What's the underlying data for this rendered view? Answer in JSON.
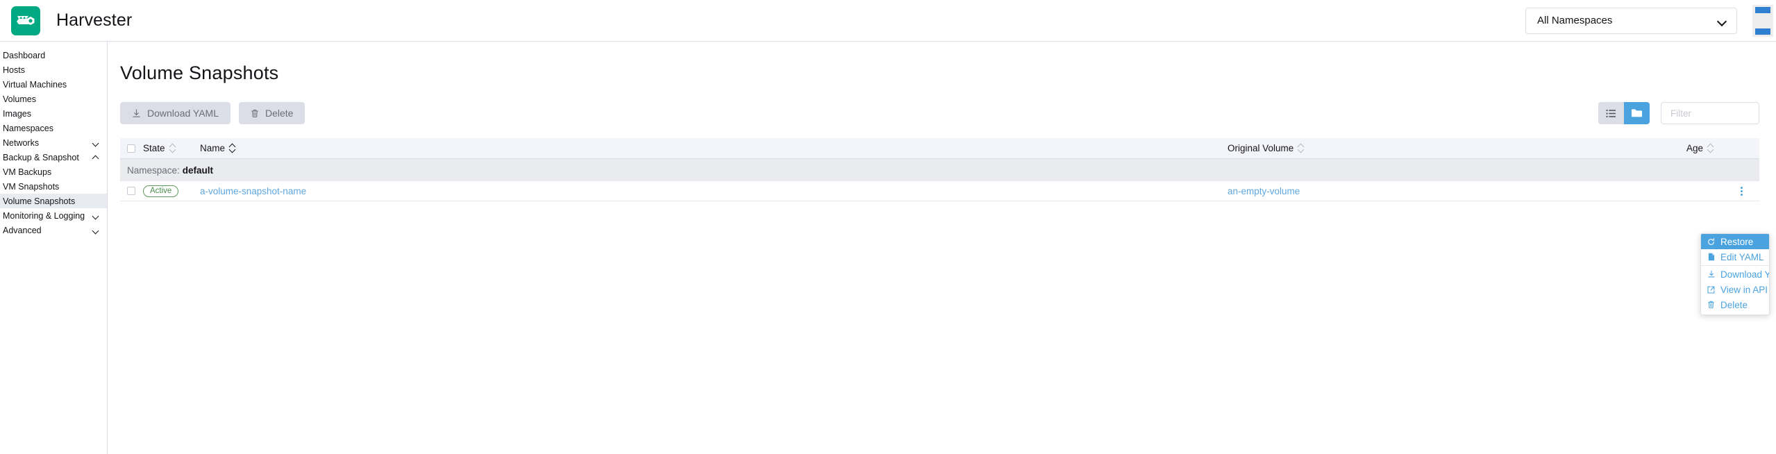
{
  "header": {
    "brand_name": "Harvester",
    "logo_icon": "harvester-logo-icon",
    "namespace_selector": {
      "value": "All Namespaces",
      "icon": "chevron-down-icon"
    }
  },
  "sidebar": {
    "items": [
      {
        "label": "Dashboard",
        "type": "link",
        "active": false
      },
      {
        "label": "Hosts",
        "type": "link",
        "active": false
      },
      {
        "label": "Virtual Machines",
        "type": "link",
        "active": false
      },
      {
        "label": "Volumes",
        "type": "link",
        "active": false
      },
      {
        "label": "Images",
        "type": "link",
        "active": false
      },
      {
        "label": "Namespaces",
        "type": "link",
        "active": false
      },
      {
        "label": "Networks",
        "type": "group",
        "active": false,
        "expanded": false,
        "icon": "chevron-down-icon"
      },
      {
        "label": "Backup & Snapshot",
        "type": "group",
        "active": false,
        "expanded": true,
        "icon": "chevron-up-icon"
      },
      {
        "label": "VM Backups",
        "type": "link",
        "active": false
      },
      {
        "label": "VM Snapshots",
        "type": "link",
        "active": false
      },
      {
        "label": "Volume Snapshots",
        "type": "link",
        "active": true
      },
      {
        "label": "Monitoring & Logging",
        "type": "group",
        "active": false,
        "expanded": false,
        "icon": "chevron-down-icon"
      },
      {
        "label": "Advanced",
        "type": "group",
        "active": false,
        "expanded": false,
        "icon": "chevron-down-icon"
      }
    ]
  },
  "main": {
    "page_title": "Volume Snapshots",
    "toolbar": {
      "download_yaml_label": "Download YAML",
      "download_yaml_icon": "download-icon",
      "delete_label": "Delete",
      "delete_icon": "trash-icon",
      "view_list_icon": "list-view-icon",
      "view_group_icon": "group-view-icon",
      "filter_placeholder": "Filter",
      "filter_value": ""
    },
    "table": {
      "columns": [
        {
          "label": "State",
          "sort": "none"
        },
        {
          "label": "Name",
          "sort": "asc"
        },
        {
          "label": "Original Volume",
          "sort": "none"
        },
        {
          "label": "Age",
          "sort": "none"
        }
      ],
      "group": {
        "label": "Namespace:",
        "value": "default"
      },
      "rows": [
        {
          "state": "Active",
          "name": "a-volume-snapshot-name",
          "original_volume": "an-empty-volume",
          "age": "",
          "actions_icon": "kebab-menu-icon"
        }
      ]
    },
    "context_menu": {
      "items": [
        {
          "label": "Restore",
          "icon": "restore-icon",
          "selected": true
        },
        {
          "label": "Edit YAML",
          "icon": "file-icon",
          "selected": false
        },
        {
          "label": "Download YAML",
          "icon": "download-icon",
          "selected": false
        },
        {
          "label": "View in API",
          "icon": "external-link-icon",
          "selected": false
        },
        {
          "label": "Delete",
          "icon": "trash-icon",
          "selected": false
        }
      ]
    }
  },
  "colors": {
    "brand_green": "#00a981",
    "accent_blue": "#4aa3df",
    "link_blue": "#5fa7e0",
    "active_green": "#4c8b4c",
    "button_gray": "#dcdee7"
  }
}
